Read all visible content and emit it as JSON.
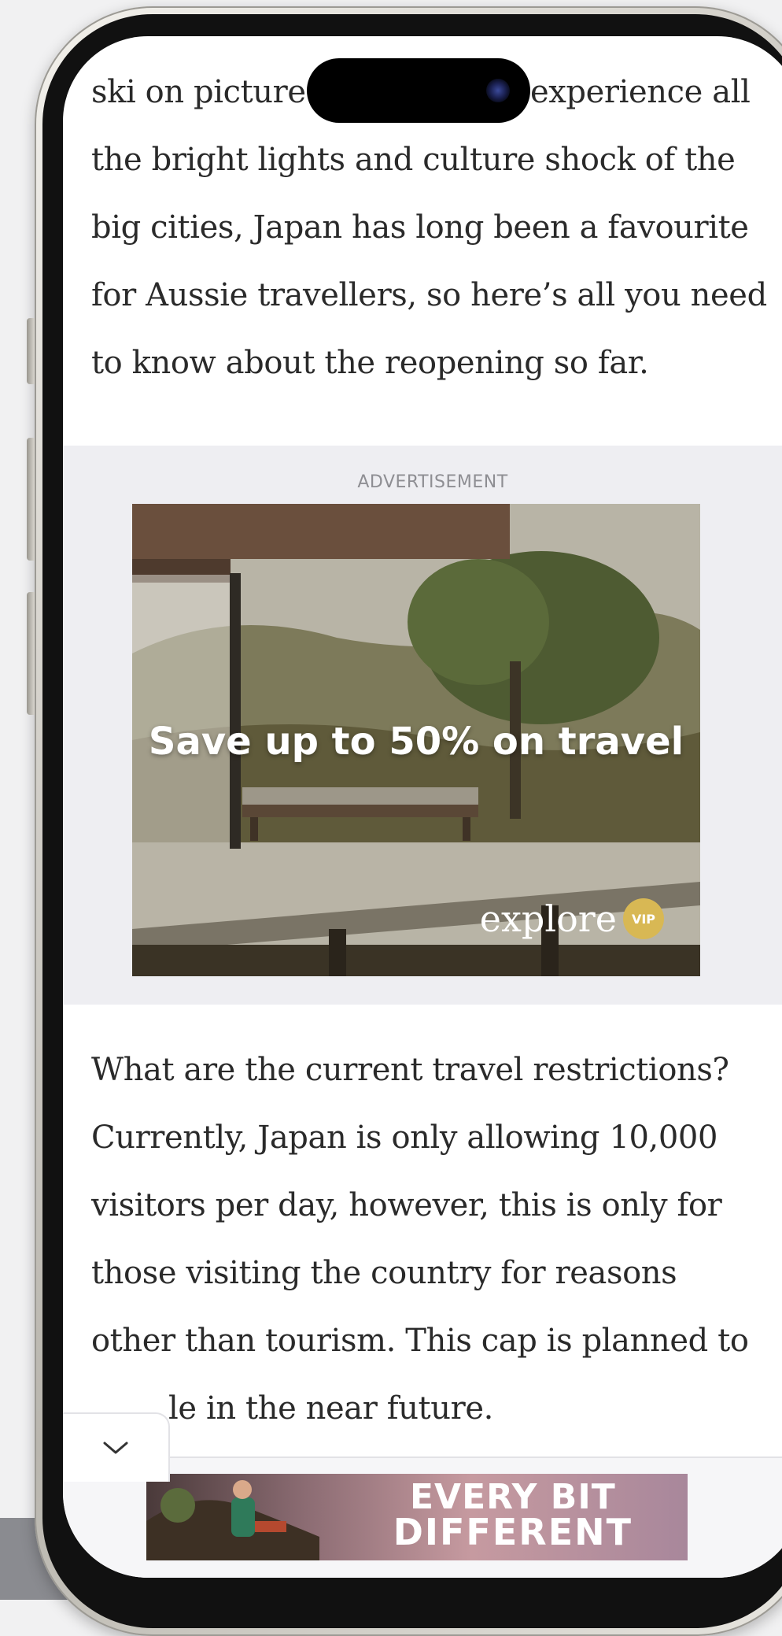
{
  "article": {
    "intro_lines": [
      "ski on picture",
      "experience all",
      "the bright lights and culture shock of the",
      "big cities, Japan has long been a favourite",
      "for Aussie travellers, so here’s all you need",
      "to know about the reopening so far."
    ],
    "body_lines": [
      "What are the current travel restrictions?",
      "Currently, Japan is only allowing 10,000",
      "visitors per day, however, this is only for",
      "those visiting the country for reasons",
      "other than tourism. This cap is planned to",
      "le in the near future."
    ]
  },
  "advertisement": {
    "label": "ADVERTISEMENT",
    "headline": "Save up to 50% on travel",
    "brand": "explore",
    "badge": "VIP"
  },
  "bottom_ad": {
    "line1": "EVERY BIT",
    "line2": "DIFFERENT"
  },
  "icons": {
    "collapse": "chevron-down-icon"
  }
}
